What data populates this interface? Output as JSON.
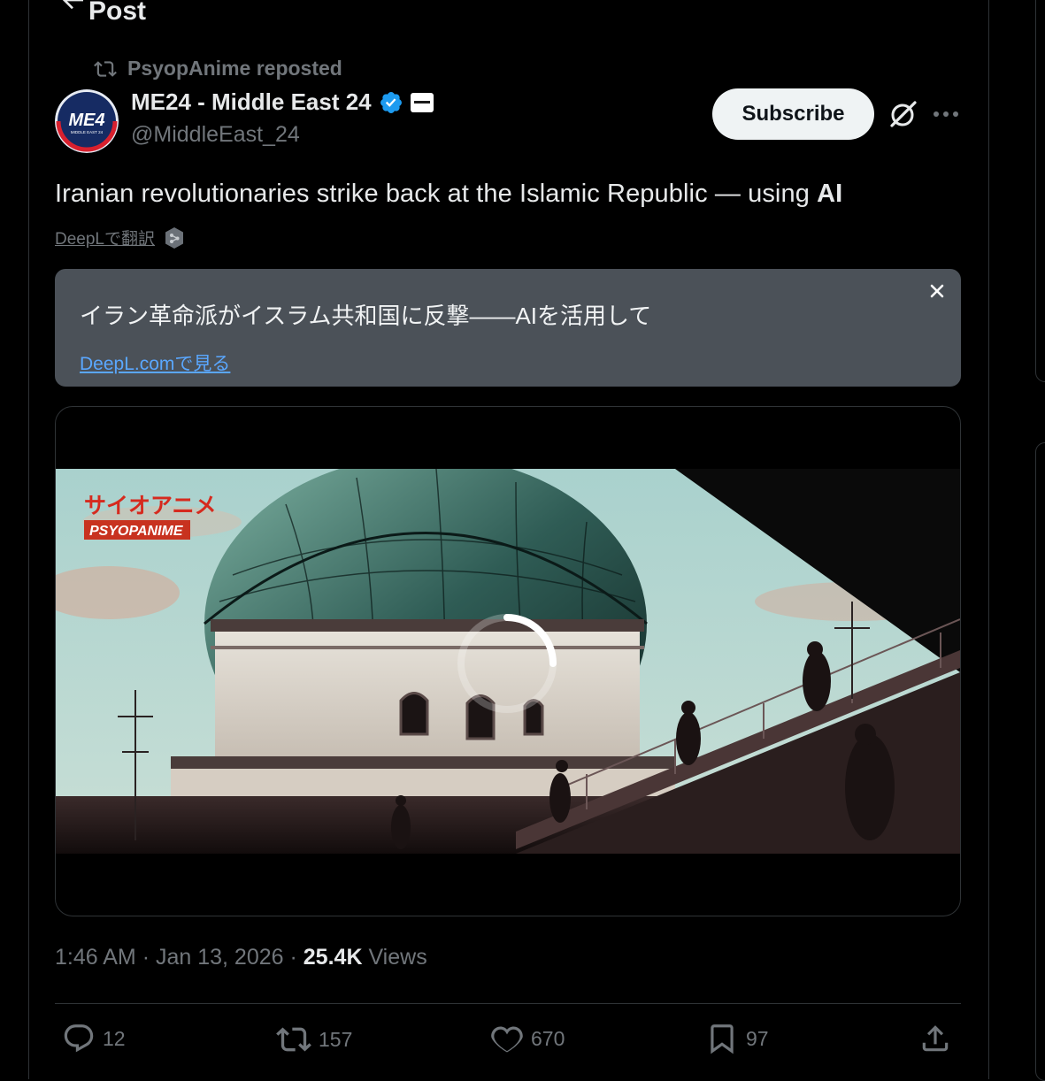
{
  "header": {
    "title": "Post"
  },
  "repost": {
    "text": "PsyopAnime reposted"
  },
  "author": {
    "name": "ME24 - Middle East 24",
    "handle": "@MiddleEast_24",
    "avatar_text": "ME4",
    "avatar_subtext": "MIDDLE EAST 24",
    "verified": true
  },
  "actions_top": {
    "subscribe_label": "Subscribe"
  },
  "post": {
    "text_before": "Iranian revolutionaries strike back at the Islamic Republic — using ",
    "text_bold": "AI",
    "translate_label": "DeepLで翻訳"
  },
  "translation": {
    "text": "イラン革命派がイスラム共和国に反撃——AIを活用して",
    "link_label": "DeepL.comで見る"
  },
  "media": {
    "watermark_jp": "サイオアニメ",
    "watermark_en": "PSYOPANIME",
    "state": "loading"
  },
  "meta": {
    "time": "1:46 AM",
    "date": "Jan 13, 2026",
    "views_count": "25.4K",
    "views_label": "Views",
    "separator": "·"
  },
  "engagement": {
    "replies": "12",
    "reposts": "157",
    "likes": "670",
    "bookmarks": "97"
  },
  "colors": {
    "background": "#000000",
    "text_primary": "#e7e9ea",
    "text_secondary": "#71767b",
    "verified": "#1d9bf0",
    "link": "#5aa7ff",
    "translation_bg": "#4b5158"
  }
}
